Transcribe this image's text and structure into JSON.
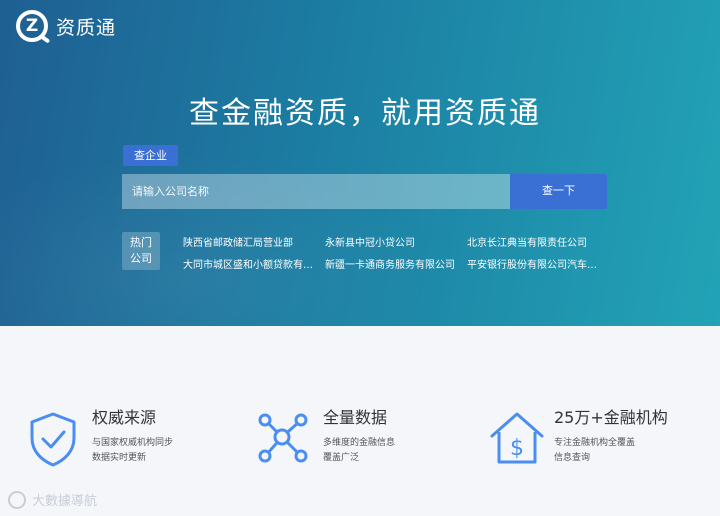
{
  "logo": {
    "text": "资质通",
    "mark": "Z"
  },
  "hero": {
    "headline": "查金融资质，就用资质通",
    "search_tab": "查企业",
    "search_placeholder": "请输入公司名称",
    "search_button": "查一下",
    "hot_label_line1": "热门",
    "hot_label_line2": "公司",
    "hot_companies": [
      "陕西省邮政储汇局营业部",
      "永新县中冠小贷公司",
      "北京长江典当有限责任公司",
      "大同市城区盛和小额贷款有限...",
      "新疆一卡通商务服务有限公司",
      "平安银行股份有限公司汽车消..."
    ]
  },
  "features": [
    {
      "title": "权威来源",
      "desc_line1": "与国家权威机构同步",
      "desc_line2": "数据实时更新",
      "icon": "shield-check-icon"
    },
    {
      "title": "全量数据",
      "desc_line1": "多维度的金融信息",
      "desc_line2": "覆盖广泛",
      "icon": "network-icon"
    },
    {
      "title": "25万+金融机构",
      "desc_line1": "专注金融机构全覆盖",
      "desc_line2": "信息查询",
      "icon": "house-dollar-icon"
    }
  ],
  "watermark": "大數據導航",
  "colors": {
    "accent": "#3a6fd3",
    "icon_blue": "#4a8ef0",
    "hero_start": "#1f5f92",
    "hero_end": "#22a3b6"
  }
}
